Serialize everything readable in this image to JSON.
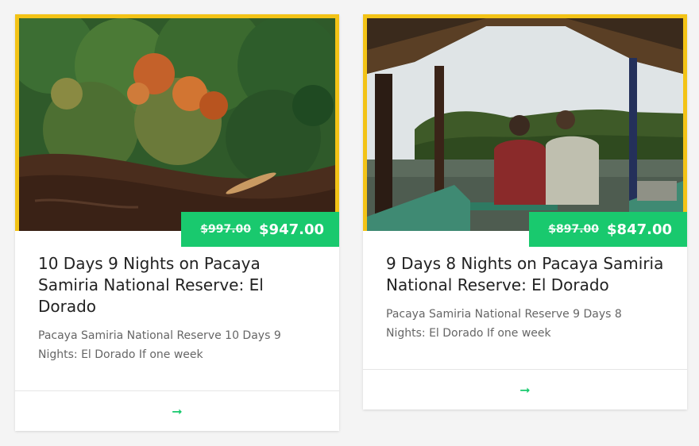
{
  "colors": {
    "accent": "#19c96e",
    "frame": "#f3c316"
  },
  "cards": [
    {
      "image_alt": "aerial view of jungle river with canoe",
      "old_price": "$997.00",
      "new_price": "$947.00",
      "title": "10 Days 9 Nights on Pacaya Samiria National Reserve: El Dorado",
      "description": "Pacaya Samiria National Reserve 10 Days 9 Nights: El Dorado If one week",
      "arrow_icon": "arrow-right-icon",
      "arrow_glyph": "➞"
    },
    {
      "image_alt": "two men on a boat looking at the river",
      "old_price": "$897.00",
      "new_price": "$847.00",
      "title": "9 Days 8 Nights on Pacaya Samiria National Reserve: El Dorado",
      "description": "Pacaya Samiria National Reserve 9 Days 8 Nights: El Dorado If one week",
      "arrow_icon": "arrow-right-icon",
      "arrow_glyph": "➞"
    }
  ]
}
